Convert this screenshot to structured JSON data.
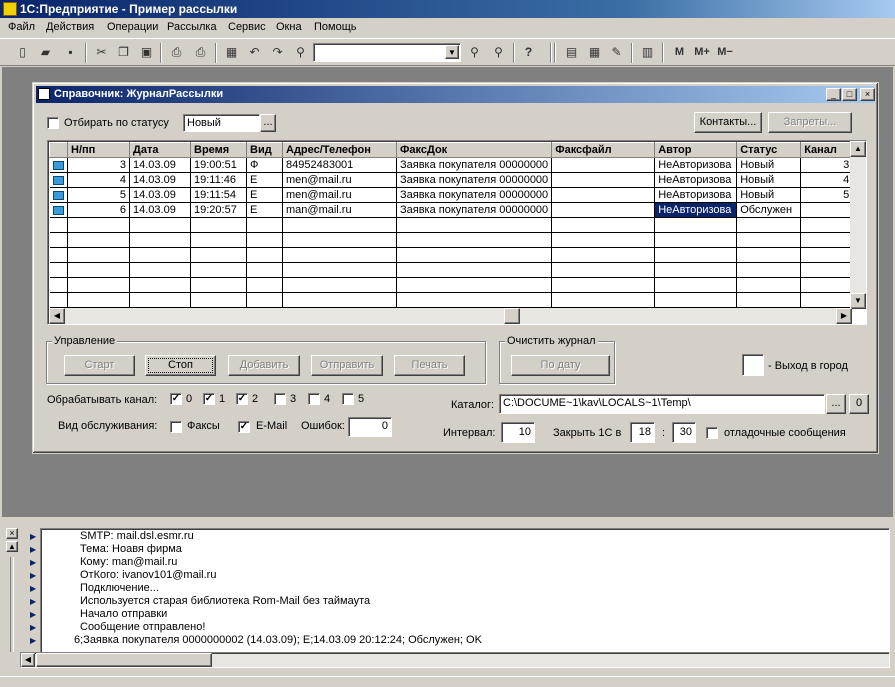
{
  "app": {
    "title": "1С:Предприятие - Пример рассылки"
  },
  "menu": [
    "Файл",
    "Действия",
    "Операции",
    "Рассылка",
    "Сервис",
    "Окна",
    "Помощь"
  ],
  "toolbar": {
    "combo_value": "",
    "m": "M",
    "m_plus": "M+",
    "m_minus": "M−"
  },
  "window": {
    "title": "Справочник: ЖурналРассылки",
    "filter_label": "Отбирать по статусу",
    "filter_value": "Новый",
    "ellipsis": "...",
    "contacts_button": "Контакты...",
    "bans_button": "Запреты..."
  },
  "grid": {
    "columns": [
      "Н/пп",
      "Дата",
      "Время",
      "Вид",
      "Адрес/Телефон",
      "ФаксДок",
      "Факсфайл",
      "Автор",
      "Статус",
      "Канал"
    ],
    "rows": [
      [
        "3",
        "14.03.09",
        "19:00:51",
        "Ф",
        "84952483001",
        "Заявка покупателя 00000000",
        "",
        "НеАвторизова",
        "Новый",
        "3"
      ],
      [
        "4",
        "14.03.09",
        "19:11:46",
        "E",
        "men@mail.ru",
        "Заявка покупателя 00000000",
        "",
        "НеАвторизова",
        "Новый",
        "4"
      ],
      [
        "5",
        "14.03.09",
        "19:11:54",
        "E",
        "men@mail.ru",
        "Заявка покупателя 00000000",
        "",
        "НеАвторизова",
        "Новый",
        "5"
      ],
      [
        "6",
        "14.03.09",
        "19:20:57",
        "E",
        "man@mail.ru",
        "Заявка покупателя 00000000",
        "",
        "НеАвторизова",
        "Обслужен",
        ""
      ]
    ],
    "selected_row": 3,
    "selected_col": 7
  },
  "control": {
    "group_title": "Управление",
    "start": "Старт",
    "stop": "Стоп",
    "add": "Добавить",
    "send": "Отправить",
    "print": "Печать"
  },
  "journal": {
    "group_title": "Очистить журнал",
    "by_date": "По дату"
  },
  "exit_label": "- Выход в город",
  "channels": {
    "label": "Обрабатывать канал:",
    "items": [
      {
        "label": "0",
        "checked": true
      },
      {
        "label": "1",
        "checked": true
      },
      {
        "label": "2",
        "checked": true
      },
      {
        "label": "3",
        "checked": false
      },
      {
        "label": "4",
        "checked": false
      },
      {
        "label": "5",
        "checked": false
      }
    ]
  },
  "service": {
    "label": "Вид обслуживания:",
    "fax_label": "Факсы",
    "fax_checked": false,
    "email_label": "E-Mail",
    "email_checked": true,
    "errors_label": "Ошибок:",
    "errors_value": "0"
  },
  "catalog": {
    "label": "Каталог:",
    "value": "C:\\DOCUME~1\\kav\\LOCALS~1\\Temp\\",
    "ellipsis": "...",
    "zero": "0"
  },
  "interval": {
    "label": "Интервал:",
    "value": "10"
  },
  "close_at": {
    "label": "Закрыть 1С в",
    "hours": "18",
    "colon": ":",
    "minutes": "30"
  },
  "debug": {
    "label": "отладочные сообщения",
    "checked": false
  },
  "messages": [
    "SMTP: mail.dsl.esmr.ru",
    "Тема: Ноавя фирма",
    "Кому: man@mail.ru",
    "ОтКого: ivanov101@mail.ru",
    "Подключение...",
    "Используется старая библиотека Rom-Mail без таймаута",
    "Начало отправки",
    "Сообщение отправлено!",
    "6;Заявка покупателя 0000000002 (14.03.09); E;14.03.09 20:12:24; Обслужен; OK"
  ]
}
